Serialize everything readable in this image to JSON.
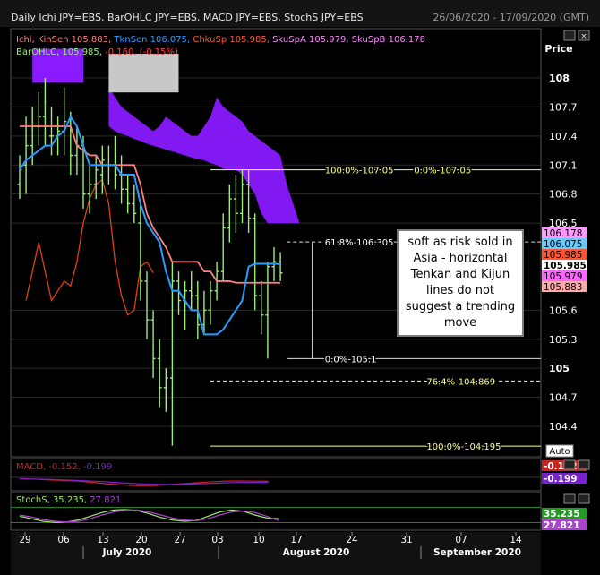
{
  "header": {
    "title": "Daily Ichi JPY=EBS, BarOHLC JPY=EBS, MACD JPY=EBS, StochS JPY=EBS",
    "date_range": "26/06/2020 - 17/09/2020 (GMT)"
  },
  "legend": {
    "ichi_label": "Ichi,",
    "kinsen": "KinSen 105.883,",
    "tknsen": "TknSen 106.075,",
    "chkusp": "ChkuSp 105.985,",
    "skuspa": "SkuSpA 105.979,",
    "skuspb": "SkuSpB 106.178",
    "bar_label": "BarOHLC,",
    "bar_value": "105.985,",
    "bar_change": "-0.160, (-0.15%)"
  },
  "price_axis": {
    "label": "Price",
    "ticks": [
      "108",
      "107.7",
      "107.4",
      "107.1",
      "106.8",
      "106.5",
      "105.6",
      "105.3",
      "105",
      "104.7",
      "104.4"
    ],
    "bold_ticks": [
      "108",
      "105"
    ],
    "badges": [
      {
        "text": "106.178",
        "bg": "#ff99ff",
        "fg": "#000000"
      },
      {
        "text": "106.075",
        "bg": "#66ccff",
        "fg": "#000000"
      },
      {
        "text": "105.985",
        "bg": "#ff5533",
        "fg": "#000000"
      },
      {
        "text": "105.985",
        "bg": "#ffffff",
        "fg": "#000000",
        "bold": true
      },
      {
        "text": "105.979",
        "bg": "#ff66ff",
        "fg": "#000000"
      },
      {
        "text": "105.883",
        "bg": "#ffaaaa",
        "fg": "#000000"
      }
    ],
    "auto_label": "Auto"
  },
  "fib_levels": [
    {
      "pct": "100.0%",
      "value": "107.05"
    },
    {
      "pct": "0.0%",
      "value": "107.05"
    },
    {
      "pct": "61.8%",
      "value": "106.305"
    },
    {
      "pct": "0.0%",
      "value": "105.1"
    },
    {
      "pct": "76.4%",
      "value": "104.869"
    },
    {
      "pct": "100.0%",
      "value": "104.195"
    }
  ],
  "annotation": "soft as risk sold in Asia - horizontal Tenkan and Kijun lines do not suggest a trending move",
  "macd": {
    "label": "MACD,",
    "v1": "-0.152,",
    "v2": "-0.199",
    "badge1": "-0.152",
    "badge2": "-0.199"
  },
  "stoch": {
    "label": "StochS,",
    "v1": "35.235,",
    "v2": "27.821",
    "badge1": "35.235",
    "badge2": "27.821"
  },
  "x_axis": {
    "ticks": [
      "29",
      "06",
      "13",
      "20",
      "27",
      "03",
      "10",
      "17",
      "24",
      "31",
      "07",
      "14"
    ],
    "months": [
      "July 2020",
      "August 2020",
      "September 2020"
    ]
  },
  "colors": {
    "cloud": "#8a1aff",
    "cloud_flat": "#c8c8c8",
    "kijun": "#ff8080",
    "tenkan": "#2a9bff",
    "chikou": "#e04018",
    "bars": "#99ee77",
    "fib": "#ffff88",
    "macd": "#cc2222",
    "macd_signal": "#7722cc",
    "stoch_k": "#99ee66",
    "stoch_d": "#aa44cc"
  },
  "chart_data": {
    "type": "line",
    "ylim": [
      104.15,
      108.3
    ],
    "ohlc": [
      {
        "o": 106.9,
        "h": 107.2,
        "l": 106.75,
        "c": 107.05
      },
      {
        "o": 107.1,
        "h": 107.6,
        "l": 106.8,
        "c": 107.3
      },
      {
        "o": 107.3,
        "h": 107.7,
        "l": 107.1,
        "c": 107.5
      },
      {
        "o": 107.5,
        "h": 107.85,
        "l": 107.3,
        "c": 107.6
      },
      {
        "o": 107.6,
        "h": 108.0,
        "l": 107.3,
        "c": 107.5
      },
      {
        "o": 107.4,
        "h": 107.7,
        "l": 107.2,
        "c": 107.4
      },
      {
        "o": 107.4,
        "h": 107.6,
        "l": 107.2,
        "c": 107.45
      },
      {
        "o": 107.45,
        "h": 107.9,
        "l": 107.2,
        "c": 107.55
      },
      {
        "o": 107.5,
        "h": 107.65,
        "l": 107.0,
        "c": 107.2
      },
      {
        "o": 107.2,
        "h": 107.5,
        "l": 107.0,
        "c": 107.3
      },
      {
        "o": 107.3,
        "h": 107.4,
        "l": 106.65,
        "c": 106.8
      },
      {
        "o": 106.8,
        "h": 107.1,
        "l": 106.6,
        "c": 106.9
      },
      {
        "o": 106.9,
        "h": 107.2,
        "l": 106.75,
        "c": 107.05
      },
      {
        "o": 107.0,
        "h": 107.3,
        "l": 106.8,
        "c": 107.15
      },
      {
        "o": 107.1,
        "h": 107.3,
        "l": 106.9,
        "c": 107.1
      },
      {
        "o": 107.1,
        "h": 107.4,
        "l": 106.85,
        "c": 107.0
      },
      {
        "o": 107.0,
        "h": 107.2,
        "l": 106.7,
        "c": 106.85
      },
      {
        "o": 106.85,
        "h": 107.0,
        "l": 106.6,
        "c": 106.7
      },
      {
        "o": 106.7,
        "h": 106.9,
        "l": 106.5,
        "c": 106.6
      },
      {
        "o": 106.5,
        "h": 106.7,
        "l": 105.7,
        "c": 105.9
      },
      {
        "o": 105.9,
        "h": 106.0,
        "l": 105.3,
        "c": 105.5
      },
      {
        "o": 105.5,
        "h": 105.6,
        "l": 104.9,
        "c": 105.1
      },
      {
        "o": 105.1,
        "h": 105.3,
        "l": 104.6,
        "c": 104.8
      },
      {
        "o": 104.8,
        "h": 105.0,
        "l": 104.55,
        "c": 104.9
      },
      {
        "o": 104.9,
        "h": 106.1,
        "l": 104.2,
        "c": 105.9
      },
      {
        "o": 105.9,
        "h": 106.0,
        "l": 105.55,
        "c": 105.7
      },
      {
        "o": 105.7,
        "h": 105.9,
        "l": 105.4,
        "c": 105.8
      },
      {
        "o": 105.8,
        "h": 106.0,
        "l": 105.6,
        "c": 105.75
      },
      {
        "o": 105.75,
        "h": 105.9,
        "l": 105.3,
        "c": 105.45
      },
      {
        "o": 105.45,
        "h": 105.8,
        "l": 105.35,
        "c": 105.6
      },
      {
        "o": 105.6,
        "h": 105.9,
        "l": 105.45,
        "c": 105.8
      },
      {
        "o": 105.8,
        "h": 106.1,
        "l": 105.7,
        "c": 106.0
      },
      {
        "o": 106.0,
        "h": 106.6,
        "l": 105.9,
        "c": 106.45
      },
      {
        "o": 106.45,
        "h": 106.9,
        "l": 106.3,
        "c": 106.75
      },
      {
        "o": 106.75,
        "h": 107.0,
        "l": 106.4,
        "c": 106.6
      },
      {
        "o": 106.6,
        "h": 107.05,
        "l": 106.5,
        "c": 106.9
      },
      {
        "o": 106.9,
        "h": 107.05,
        "l": 106.4,
        "c": 106.55
      },
      {
        "o": 106.55,
        "h": 106.6,
        "l": 105.6,
        "c": 105.75
      },
      {
        "o": 105.75,
        "h": 105.9,
        "l": 105.35,
        "c": 105.55
      },
      {
        "o": 105.55,
        "h": 106.1,
        "l": 105.1,
        "c": 106.05
      },
      {
        "o": 106.05,
        "h": 106.25,
        "l": 105.9,
        "c": 106.1
      },
      {
        "o": 106.1,
        "h": 106.2,
        "l": 105.9,
        "c": 105.985
      }
    ],
    "tenkan": [
      107.05,
      107.15,
      107.2,
      107.25,
      107.3,
      107.3,
      107.4,
      107.45,
      107.6,
      107.5,
      107.3,
      107.1,
      107.1,
      107.1,
      107.1,
      107.1,
      107.0,
      107.0,
      107.0,
      106.7,
      106.5,
      106.4,
      106.3,
      106.0,
      105.8,
      105.8,
      105.7,
      105.6,
      105.6,
      105.35,
      105.35,
      105.35,
      105.4,
      105.5,
      105.6,
      105.7,
      106.05,
      106.08,
      106.08,
      106.08,
      106.08,
      106.075
    ],
    "kijun": [
      107.5,
      107.5,
      107.5,
      107.5,
      107.5,
      107.5,
      107.5,
      107.5,
      107.5,
      107.3,
      107.25,
      107.2,
      107.2,
      107.1,
      107.1,
      107.1,
      107.1,
      107.1,
      107.1,
      106.9,
      106.6,
      106.45,
      106.35,
      106.25,
      106.1,
      106.1,
      106.1,
      106.1,
      106.1,
      106.0,
      106.0,
      105.9,
      105.9,
      105.9,
      105.883,
      105.883,
      105.883,
      105.883,
      105.883,
      105.883,
      105.883,
      105.883
    ],
    "chikou": [
      105.7,
      106.0,
      106.3,
      106.0,
      105.7,
      105.8,
      105.9,
      105.85,
      106.1,
      106.5,
      106.75,
      106.9,
      106.95,
      106.7,
      106.1,
      105.75,
      105.55,
      105.6,
      106.05,
      106.1,
      105.985
    ],
    "cloud_top": [
      107.9,
      107.8,
      107.7,
      107.65,
      107.6,
      107.55,
      107.5,
      107.45,
      107.5,
      107.6,
      107.55,
      107.5,
      107.45,
      107.4,
      107.4,
      107.5,
      107.6,
      107.8,
      107.7,
      107.65,
      107.6,
      107.55,
      107.45,
      107.4,
      107.35,
      107.3,
      107.25,
      107.2,
      106.9,
      106.7,
      106.5,
      106.3
    ],
    "cloud_bottom": [
      107.5,
      107.45,
      107.42,
      107.4,
      107.37,
      107.35,
      107.32,
      107.3,
      107.28,
      107.26,
      107.24,
      107.22,
      107.2,
      107.18,
      107.16,
      107.15,
      107.12,
      107.1,
      107.06,
      107.05,
      107.05,
      107.0,
      106.9,
      106.8,
      106.6,
      106.5,
      106.5,
      106.5,
      106.5,
      106.5,
      106.5,
      106.3
    ],
    "macd": [
      -0.05,
      -0.07,
      -0.1,
      -0.12,
      -0.15,
      -0.2,
      -0.26,
      -0.3,
      -0.33,
      -0.33,
      -0.3,
      -0.26,
      -0.22,
      -0.18,
      -0.15,
      -0.14,
      -0.15,
      -0.152
    ],
    "macd_signal": [
      -0.06,
      -0.07,
      -0.08,
      -0.1,
      -0.12,
      -0.15,
      -0.18,
      -0.22,
      -0.25,
      -0.27,
      -0.28,
      -0.28,
      -0.26,
      -0.24,
      -0.22,
      -0.2,
      -0.2,
      -0.199
    ],
    "stoch_k": [
      45,
      35,
      25,
      20,
      22,
      30,
      45,
      60,
      70,
      72,
      68,
      55,
      40,
      30,
      25,
      28,
      45,
      62,
      70,
      65,
      50,
      38,
      35.235
    ],
    "stoch_d": [
      50,
      42,
      32,
      25,
      22,
      25,
      35,
      50,
      62,
      70,
      70,
      62,
      50,
      38,
      30,
      27,
      35,
      50,
      62,
      66,
      60,
      45,
      27.821
    ]
  }
}
